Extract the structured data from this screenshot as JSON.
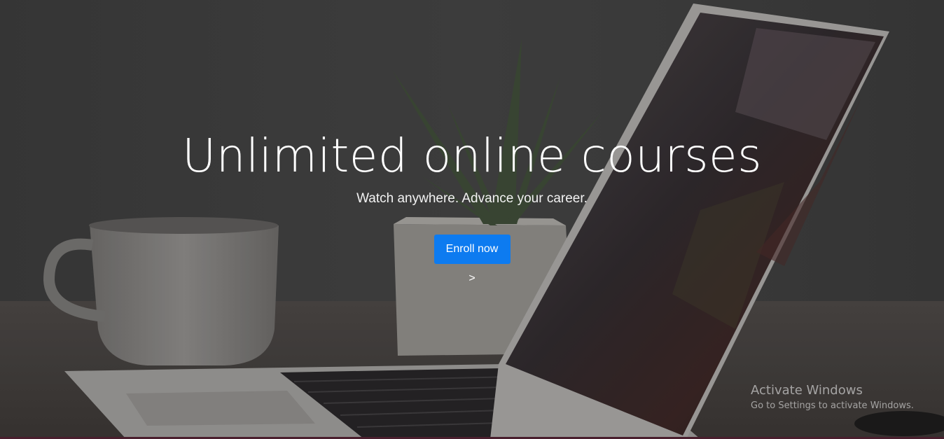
{
  "hero": {
    "title": "Unlimited online courses",
    "subtitle": "Watch anywhere. Advance your career.",
    "cta_label": "Enroll now >"
  },
  "watermark": {
    "title": "Activate Windows",
    "subtitle": "Go to Settings to activate Windows."
  },
  "colors": {
    "cta_background": "#0d7bf0",
    "text": "#ffffff",
    "watermark_text": "#c8c8c8"
  }
}
